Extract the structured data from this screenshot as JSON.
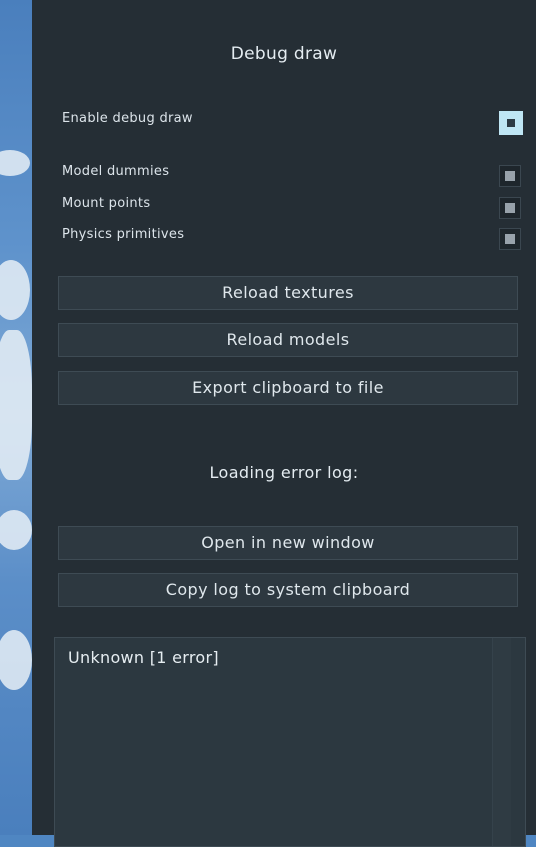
{
  "header": {
    "title": "Debug draw"
  },
  "toggles": {
    "enable_label": "Enable debug draw",
    "items": [
      {
        "label": "Model dummies"
      },
      {
        "label": "Mount points"
      },
      {
        "label": "Physics primitives"
      }
    ]
  },
  "actions": {
    "reload_textures": "Reload textures",
    "reload_models": "Reload models",
    "export_clipboard": "Export clipboard to file"
  },
  "error_log": {
    "heading": "Loading error log:",
    "open_new_window": "Open in new window",
    "copy_to_clipboard": "Copy log to system clipboard",
    "entry": "Unknown [1 error]"
  }
}
